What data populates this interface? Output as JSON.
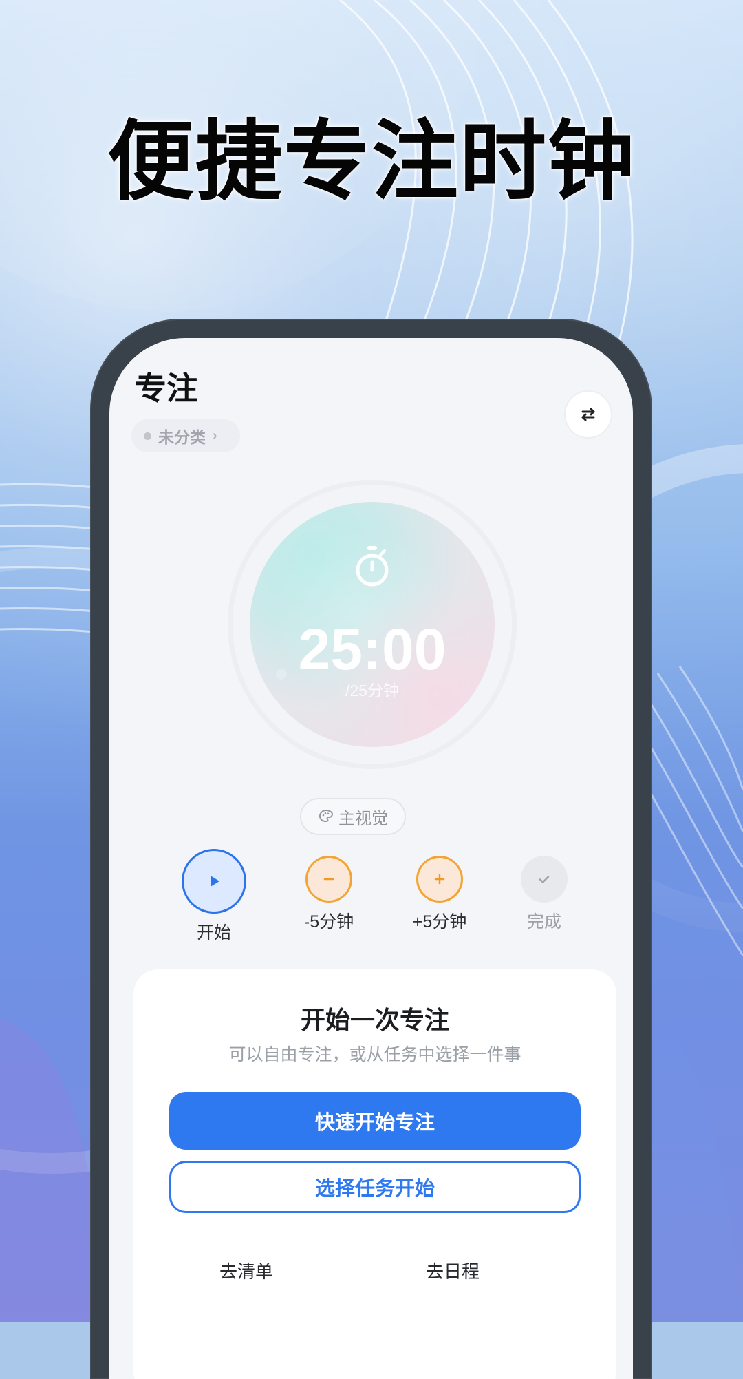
{
  "headline": "便捷专注时钟",
  "screen": {
    "title": "专注",
    "category_chip": {
      "label": "未分类",
      "arrow": "›"
    },
    "icons": {
      "swap": "swap-icon",
      "stopwatch": "stopwatch-icon",
      "palette": "palette-icon",
      "play": "play-icon",
      "minus": "minus-icon",
      "plus": "plus-icon",
      "check": "check-icon"
    },
    "timer": {
      "time": "25:00",
      "goal": "/25分钟"
    },
    "theme_chip": {
      "label": "主视觉"
    },
    "actions": [
      {
        "label": "开始"
      },
      {
        "label": "-5分钟"
      },
      {
        "label": "+5分钟"
      },
      {
        "label": "完成"
      }
    ],
    "card": {
      "title": "开始一次专注",
      "subtitle": "可以自由专注，或从任务中选择一件事",
      "primary_button": "快速开始专注",
      "secondary_button": "选择任务开始",
      "links": [
        "去清单",
        "去日程"
      ]
    }
  },
  "colors": {
    "accent_blue": "#2f79f0",
    "accent_orange": "#f3a432",
    "phone_frame": "#39414b"
  }
}
